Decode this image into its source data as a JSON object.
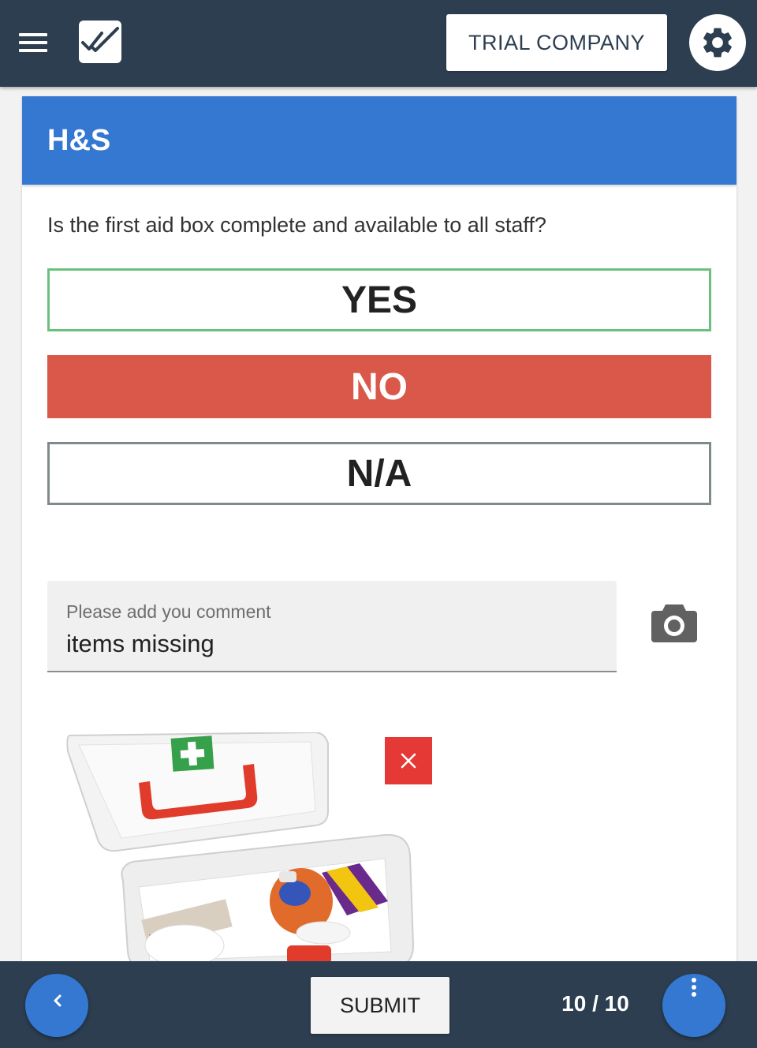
{
  "header": {
    "company_label": "TRIAL COMPANY",
    "icons": {
      "menu": "hamburger-menu-icon",
      "logo": "double-check-icon",
      "settings": "gear-icon"
    }
  },
  "section": {
    "title": "H&S",
    "question": "Is the first aid box complete and available to all staff?",
    "answers": [
      {
        "label": "YES",
        "color": "#6cc07d",
        "selected": false
      },
      {
        "label": "NO",
        "color": "#d9584a",
        "selected": true
      },
      {
        "label": "N/A",
        "color": "#7f8a8c",
        "selected": false
      }
    ],
    "comment": {
      "placeholder": "Please add you comment",
      "value": "items missing"
    },
    "camera_icon": "camera-icon",
    "attachment": {
      "delete_icon": "close-icon"
    }
  },
  "footer": {
    "submit_label": "SUBMIT",
    "progress": "10 / 10",
    "icons": {
      "back": "chevron-left-icon",
      "more": "more-vertical-icon"
    }
  },
  "colors": {
    "topbar": "#2c3e50",
    "header_blue": "#3578d1",
    "no_red": "#d9584a",
    "delete_red": "#e53935"
  }
}
